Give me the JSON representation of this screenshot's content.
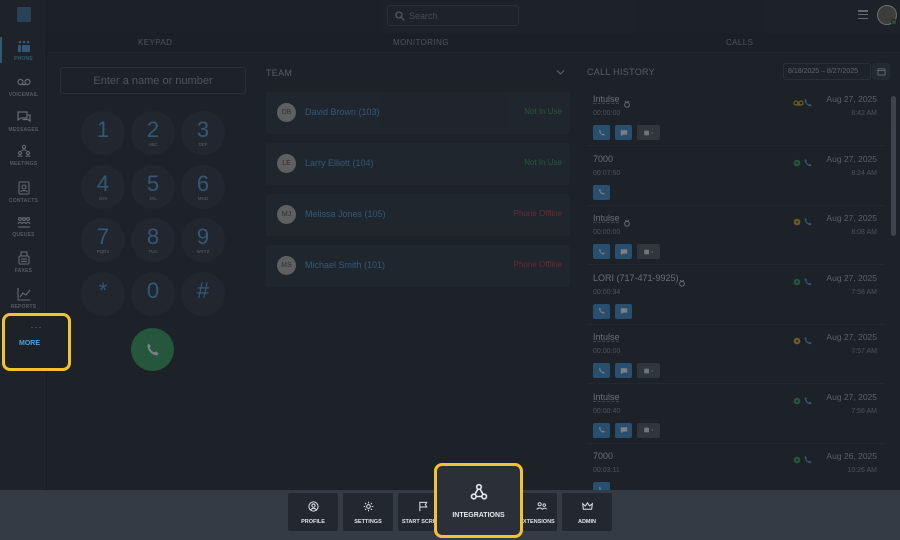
{
  "nav": {
    "items": [
      {
        "label": "PHONE",
        "icon": "dialpad-icon"
      },
      {
        "label": "VOICEMAIL",
        "icon": "voicemail-icon"
      },
      {
        "label": "MESSAGES",
        "icon": "chat-icon"
      },
      {
        "label": "MEETINGS",
        "icon": "meeting-icon"
      },
      {
        "label": "CONTACTS",
        "icon": "contacts-icon"
      },
      {
        "label": "QUEUES",
        "icon": "queues-icon"
      },
      {
        "label": "FAXES",
        "icon": "fax-icon"
      },
      {
        "label": "REPORTS",
        "icon": "reports-icon"
      }
    ],
    "more": {
      "dots": "···",
      "label": "MORE"
    }
  },
  "topbar": {
    "search_placeholder": "Search"
  },
  "tabs": {
    "keypad": "KEYPAD",
    "monitoring": "MONITORING",
    "calls": "CALLS"
  },
  "keypad": {
    "placeholder": "Enter a name or number",
    "keys": [
      {
        "digit": "1",
        "sub": ""
      },
      {
        "digit": "2",
        "sub": "ABC"
      },
      {
        "digit": "3",
        "sub": "DEF"
      },
      {
        "digit": "4",
        "sub": "GHI"
      },
      {
        "digit": "5",
        "sub": "JKL"
      },
      {
        "digit": "6",
        "sub": "MNO"
      },
      {
        "digit": "7",
        "sub": "PQRS"
      },
      {
        "digit": "8",
        "sub": "TUV"
      },
      {
        "digit": "9",
        "sub": "WXYZ"
      },
      {
        "digit": "*",
        "sub": ""
      },
      {
        "digit": "0",
        "sub": ""
      },
      {
        "digit": "#",
        "sub": ""
      }
    ]
  },
  "team": {
    "title": "TEAM",
    "members": [
      {
        "initials": "DB",
        "name": "David Brown (103)",
        "status": "Not In Use",
        "state": "ok"
      },
      {
        "initials": "LE",
        "name": "Larry Elliott (104)",
        "status": "Not In Use",
        "state": "ok"
      },
      {
        "initials": "MJ",
        "name": "Melissa Jones (105)",
        "status": "Phone Offline",
        "state": "off"
      },
      {
        "initials": "MS",
        "name": "Michael Smith (101)",
        "status": "Phone Offline",
        "state": "off"
      }
    ]
  },
  "calls": {
    "title": "CALL HISTORY",
    "date_range": "8/18/2025 – 8/27/2025",
    "items": [
      {
        "name": "Intulse",
        "underlined": true,
        "recorded": true,
        "duration": "00:00:00",
        "date": "Aug 27, 2025",
        "time": "8:42 AM",
        "status": "voicemail",
        "actions": 3
      },
      {
        "name": "7000",
        "underlined": false,
        "recorded": false,
        "duration": "00:07:50",
        "date": "Aug 27, 2025",
        "time": "8:24 AM",
        "status": "answered",
        "actions": 1
      },
      {
        "name": "Intulse",
        "underlined": true,
        "recorded": true,
        "duration": "00:00:00",
        "date": "Aug 27, 2025",
        "time": "8:08 AM",
        "status": "missed",
        "actions": 3
      },
      {
        "name": "LORI (717-471-9925)",
        "underlined": false,
        "recorded": true,
        "duration": "00:00:34",
        "date": "Aug 27, 2025",
        "time": "7:58 AM",
        "status": "answered",
        "actions": 2
      },
      {
        "name": "Intulse",
        "underlined": true,
        "recorded": false,
        "duration": "00:00:00",
        "date": "Aug 27, 2025",
        "time": "7:57 AM",
        "status": "missed",
        "actions": 3
      },
      {
        "name": "Intulse",
        "underlined": true,
        "recorded": false,
        "duration": "00:00:40",
        "date": "Aug 27, 2025",
        "time": "7:56 AM",
        "status": "answered",
        "actions": 3
      },
      {
        "name": "7000",
        "underlined": false,
        "recorded": false,
        "duration": "00:03:11",
        "date": "Aug 26, 2025",
        "time": "10:26 AM",
        "status": "answered",
        "actions": 1
      }
    ]
  },
  "dock": {
    "items": [
      {
        "label": "PROFILE",
        "icon": "profile-icon"
      },
      {
        "label": "SETTINGS",
        "icon": "gear-icon"
      },
      {
        "label": "START SCREEN",
        "icon": "flag-icon"
      },
      {
        "label": "INTEGRATIONS",
        "icon": "integrations-icon"
      },
      {
        "label": "EXTENSIONS",
        "icon": "extensions-icon"
      },
      {
        "label": "ADMIN",
        "icon": "crown-icon"
      }
    ]
  },
  "colors": {
    "accent": "#4fa3e0",
    "highlight": "#f2c230",
    "online": "#2fa157",
    "offline": "#d8334a"
  }
}
